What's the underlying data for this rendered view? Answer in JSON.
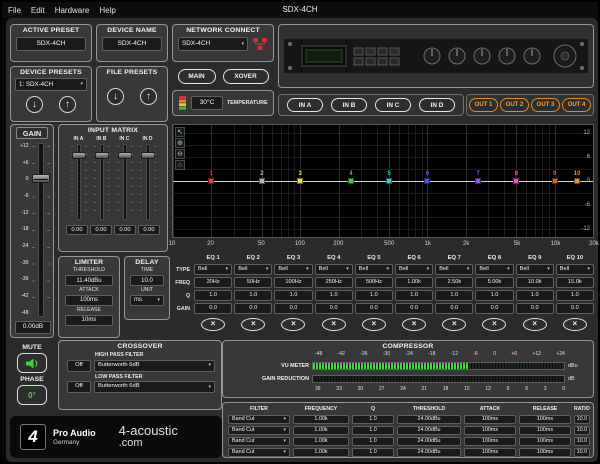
{
  "window": {
    "title": "SDX-4CH",
    "menu": [
      "File",
      "Edit",
      "Hardware",
      "Help"
    ]
  },
  "presets": {
    "active_label": "ACTIVE PRESET",
    "active_value": "SDX-4CH",
    "device_name_label": "DEVICE NAME",
    "device_name_value": "SDX-4CH",
    "device_presets_label": "DEVICE PRESETS",
    "device_presets_value": "1: SDX-4CH",
    "file_presets_label": "FILE PRESETS",
    "recall_glyph": "↓",
    "store_glyph": "↑"
  },
  "network": {
    "label": "NETWORK CONNECT",
    "value": "SDX-4CH"
  },
  "view_buttons": {
    "main": "MAIN",
    "xover": "XOVER"
  },
  "temperature": {
    "value": "30°C",
    "label": "TEMPERATURE"
  },
  "channels": {
    "inputs": [
      "IN A",
      "IN B",
      "IN C",
      "IN D"
    ],
    "outputs": [
      "OUT 1",
      "OUT 2",
      "OUT 3",
      "OUT 4"
    ],
    "output_accent": "#e8871e"
  },
  "gain": {
    "title": "GAIN",
    "scale": [
      "+12",
      "+6",
      "0",
      "-6",
      "-12",
      "-18",
      "-24",
      "-30",
      "-36",
      "-42",
      "-48"
    ],
    "value": "0.00dB",
    "mute_label": "MUTE",
    "phase_label": "PHASE",
    "phase_value": "0°"
  },
  "input_matrix": {
    "title": "INPUT MATRIX",
    "channels": [
      "IN A",
      "IN B",
      "IN C",
      "IN D"
    ],
    "values": [
      "0.00",
      "0.00",
      "0.00",
      "0.00"
    ]
  },
  "limiter": {
    "title": "LIMITER",
    "threshold_label": "THRESHOLD",
    "threshold": "11.40dBu",
    "attack_label": "ATTACK",
    "attack": "100ms",
    "release_label": "RELEASE",
    "release": "10ms"
  },
  "delay": {
    "title": "DELAY",
    "time_label": "TIME",
    "time": "10.0",
    "unit_label": "UNIT",
    "unit": "ms"
  },
  "plot_tools": [
    {
      "name": "cursor-tool-icon",
      "glyph": "↖"
    },
    {
      "name": "zoom-in-tool-icon",
      "glyph": "⊕"
    },
    {
      "name": "zoom-out-tool-icon",
      "glyph": "⊖"
    },
    {
      "name": "reset-view-tool-icon",
      "glyph": "○"
    }
  ],
  "chart_data": {
    "type": "line",
    "title": "EQ frequency response",
    "x_ticks": [
      "10",
      "20",
      "50",
      "100",
      "200",
      "500",
      "1k",
      "2k",
      "5k",
      "10k",
      "20k"
    ],
    "x_tick_freqs": [
      10,
      20,
      50,
      100,
      200,
      500,
      1000,
      2000,
      5000,
      10000,
      20000
    ],
    "y_ticks": [
      "12",
      "6",
      "0",
      "-6",
      "-12"
    ],
    "xlim_hz": [
      10,
      20000
    ],
    "ylim_db": [
      -14,
      14
    ],
    "grid": true,
    "response_db": 0,
    "markers": [
      {
        "n": "1",
        "freq": 20,
        "gain": 0,
        "color": "#e04040"
      },
      {
        "n": "2",
        "freq": 50,
        "gain": 0,
        "color": "#b8b8b8"
      },
      {
        "n": "3",
        "freq": 100,
        "gain": 0,
        "color": "#e6e050"
      },
      {
        "n": "4",
        "freq": 250,
        "gain": 0,
        "color": "#46c846"
      },
      {
        "n": "5",
        "freq": 500,
        "gain": 0,
        "color": "#46c8c8"
      },
      {
        "n": "6",
        "freq": 1000,
        "gain": 0,
        "color": "#4858e0"
      },
      {
        "n": "7",
        "freq": 2500,
        "gain": 0,
        "color": "#9850e0"
      },
      {
        "n": "8",
        "freq": 5000,
        "gain": 0,
        "color": "#e050c8"
      },
      {
        "n": "9",
        "freq": 10000,
        "gain": 0,
        "color": "#c86428"
      },
      {
        "n": "10",
        "freq": 15000,
        "gain": 0,
        "color": "#e09040"
      }
    ]
  },
  "eq": {
    "row_labels": {
      "type": "TYPE",
      "freq": "FREQ",
      "q": "Q",
      "gain": "GAIN"
    },
    "bypass_glyph": "×",
    "bands": [
      {
        "name": "EQ 1",
        "type": "Bell",
        "freq": "20Hz",
        "q": "1.0",
        "gain": "0.0"
      },
      {
        "name": "EQ 2",
        "type": "Bell",
        "freq": "50Hz",
        "q": "1.0",
        "gain": "0.0"
      },
      {
        "name": "EQ 3",
        "type": "Bell",
        "freq": "100Hz",
        "q": "1.0",
        "gain": "0.0"
      },
      {
        "name": "EQ 4",
        "type": "Bell",
        "freq": "250Hz",
        "q": "1.0",
        "gain": "0.0"
      },
      {
        "name": "EQ 5",
        "type": "Bell",
        "freq": "500Hz",
        "q": "1.0",
        "gain": "0.0"
      },
      {
        "name": "EQ 6",
        "type": "Bell",
        "freq": "1.00k",
        "q": "1.0",
        "gain": "0.0"
      },
      {
        "name": "EQ 7",
        "type": "Bell",
        "freq": "2.50k",
        "q": "1.0",
        "gain": "0.0"
      },
      {
        "name": "EQ 8",
        "type": "Bell",
        "freq": "5.00k",
        "q": "1.0",
        "gain": "0.0"
      },
      {
        "name": "EQ 9",
        "type": "Bell",
        "freq": "10.0k",
        "q": "1.0",
        "gain": "0.0"
      },
      {
        "name": "EQ 10",
        "type": "Bell",
        "freq": "15.0k",
        "q": "1.0",
        "gain": "0.0"
      }
    ]
  },
  "crossover": {
    "title": "CROSSOVER",
    "filters": [
      {
        "label": "HIGH PASS FILTER",
        "state": "Off",
        "type": "Butterworth 6dB"
      },
      {
        "label": "LOW PASS FILTER",
        "state": "Off",
        "type": "Butterworth 6dB"
      }
    ]
  },
  "compressor": {
    "title": "COMPRESSOR",
    "input_scale": [
      "-48",
      "-42",
      "-36",
      "-30",
      "-24",
      "-18",
      "-12",
      "-6",
      "0",
      "+6",
      "+12",
      "+24"
    ],
    "vu_label": "VU METER",
    "vu_unit": "dBu",
    "vu_fill_pct": 62,
    "gr_label": "GAIN REDUCTION",
    "gr_unit": "dB",
    "gr_scale": [
      "36",
      "33",
      "30",
      "27",
      "24",
      "21",
      "18",
      "15",
      "12",
      "9",
      "6",
      "3",
      "0"
    ]
  },
  "filter_table": {
    "headers": [
      "FILTER",
      "FREQUENCY",
      "Q",
      "THRESHOLD",
      "ATTACK",
      "RELEASE",
      "RATIO"
    ],
    "rows": [
      {
        "filter": "Band Cut",
        "frequency": "1.00k",
        "q": "1.0",
        "threshold": "24.00dBu",
        "attack": "100ms",
        "release": "100ms",
        "ratio": "10.0"
      },
      {
        "filter": "Band Cut",
        "frequency": "1.00k",
        "q": "1.0",
        "threshold": "24.00dBu",
        "attack": "100ms",
        "release": "100ms",
        "ratio": "10.0"
      },
      {
        "filter": "Band Cut",
        "frequency": "1.00k",
        "q": "1.0",
        "threshold": "24.00dBu",
        "attack": "100ms",
        "release": "100ms",
        "ratio": "10.0"
      },
      {
        "filter": "Band Cut",
        "frequency": "1.00k",
        "q": "1.0",
        "threshold": "24.00dBu",
        "attack": "100ms",
        "release": "100ms",
        "ratio": "10.0"
      }
    ]
  },
  "branding": {
    "logo_glyph": "4",
    "line1": "Pro Audio",
    "line2": "Germany",
    "site_line1": "4-acoustic",
    "site_line2": ".com"
  }
}
